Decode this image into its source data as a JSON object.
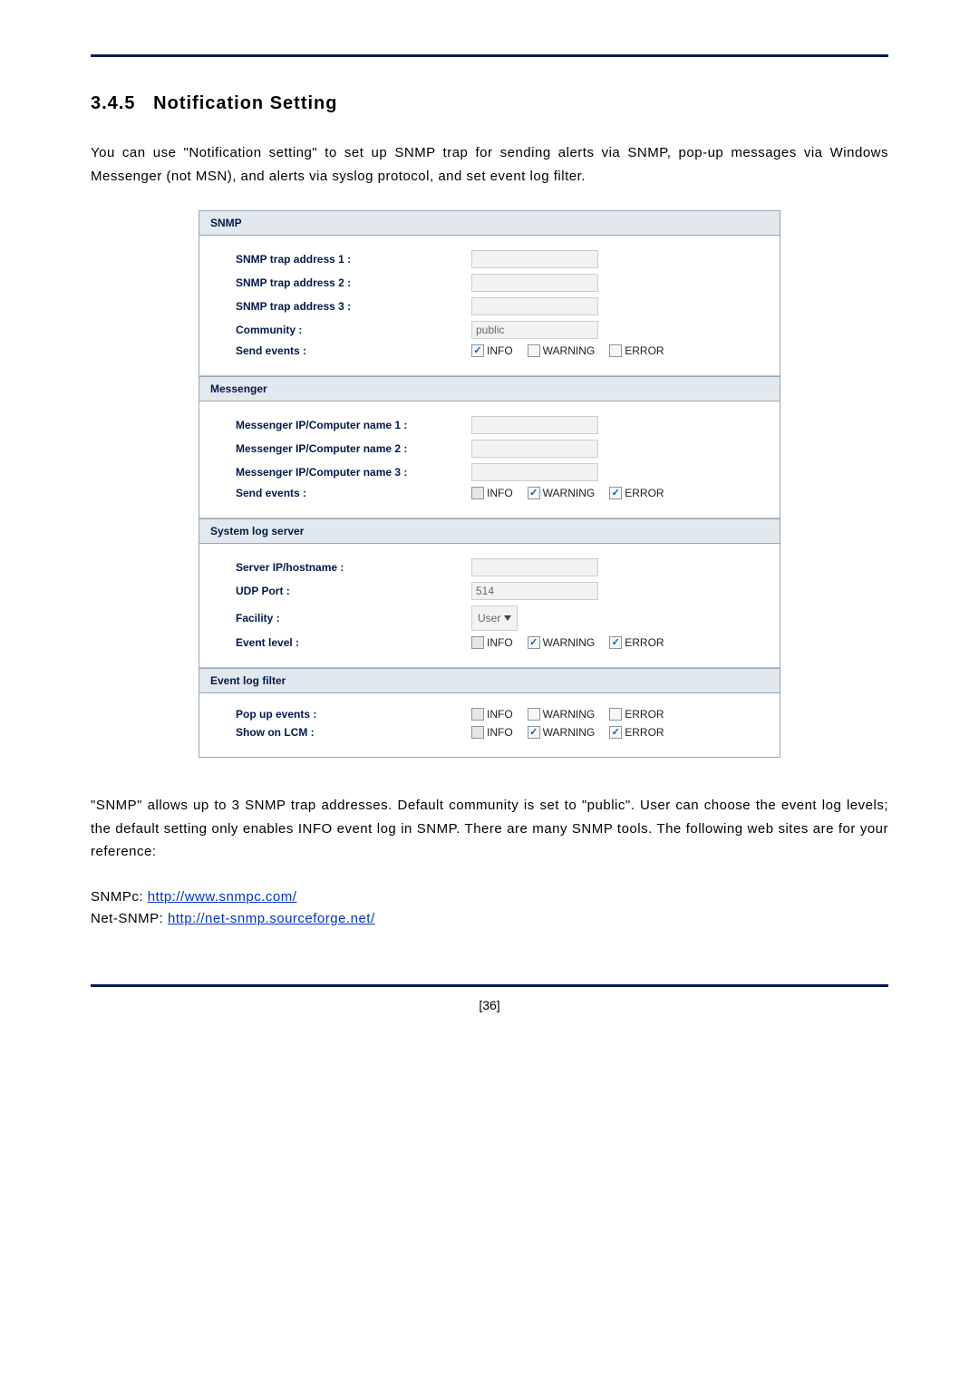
{
  "doc": {
    "section_number": "3.4.5",
    "section_title": "Notification Setting",
    "intro": "You can use \"Notification setting\" to set up SNMP trap for sending alerts via SNMP, pop-up messages via Windows Messenger (not MSN), and alerts via syslog protocol, and set event log filter.",
    "outro": "\"SNMP\" allows up to 3 SNMP trap addresses. Default community is set to \"public\". User can choose the event log levels; the default setting only enables INFO event log in SNMP. There are many SNMP tools. The following web sites are for your reference:",
    "ref1_label": "SNMPc:",
    "ref1_url": "http://www.snmpc.com/",
    "ref2_label": "Net-SNMP:",
    "ref2_url": "http://net-snmp.sourceforge.net/",
    "page_num": "[36]"
  },
  "panel": {
    "snmp": {
      "header": "SNMP",
      "addr1_label": "SNMP trap address 1 :",
      "addr2_label": "SNMP trap address 2 :",
      "addr3_label": "SNMP trap address 3 :",
      "community_label": "Community :",
      "community_value": "public",
      "send_label": "Send events :",
      "opts": {
        "info": "INFO",
        "warn": "WARNING",
        "err": "ERROR"
      }
    },
    "msgr": {
      "header": "Messenger",
      "ip1": "Messenger IP/Computer name 1 :",
      "ip2": "Messenger IP/Computer name 2 :",
      "ip3": "Messenger IP/Computer name 3 :",
      "send_label": "Send events :",
      "opts": {
        "info": "INFO",
        "warn": "WARNING",
        "err": "ERROR"
      }
    },
    "syslog": {
      "header": "System log server",
      "host_label": "Server IP/hostname :",
      "port_label": "UDP Port :",
      "port_value": "514",
      "facility_label": "Facility :",
      "facility_value": "User",
      "event_label": "Event level :",
      "opts": {
        "info": "INFO",
        "warn": "WARNING",
        "err": "ERROR"
      }
    },
    "filter": {
      "header": "Event log filter",
      "popup_label": "Pop up events :",
      "lcm_label": "Show on LCM :",
      "opts": {
        "info": "INFO",
        "warn": "WARNING",
        "err": "ERROR"
      }
    }
  }
}
